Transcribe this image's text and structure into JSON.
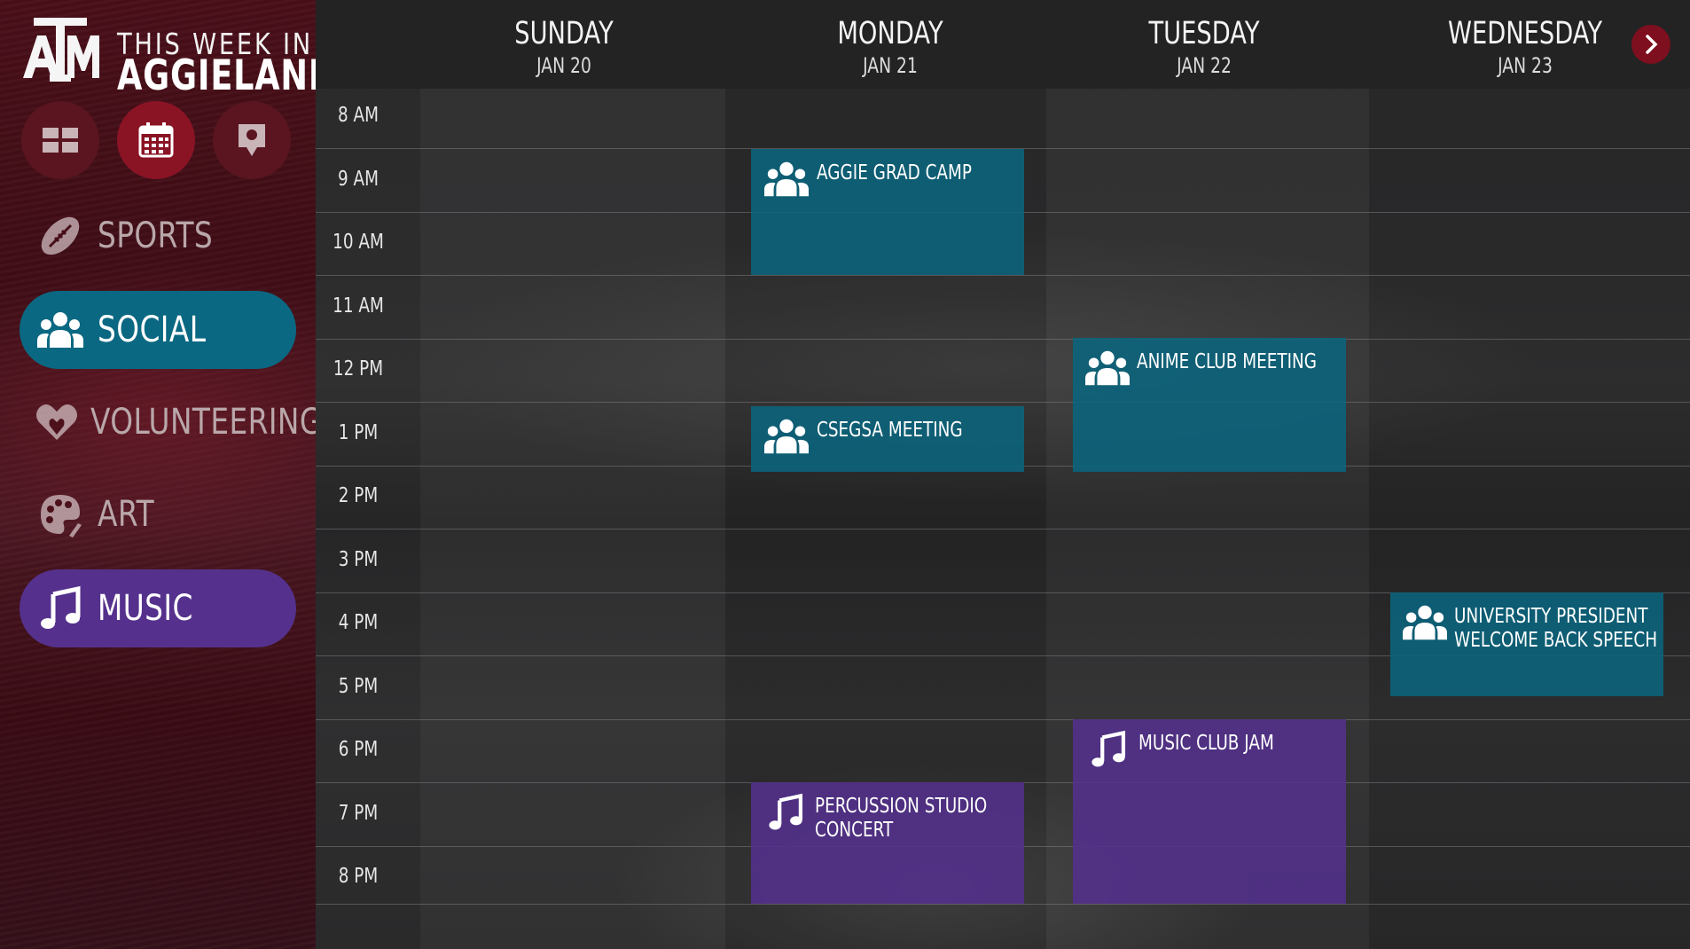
{
  "brand": {
    "logo_text": "ATM",
    "line1": "THIS WEEK IN",
    "line2": "AGGIELAND"
  },
  "colors": {
    "maroon": "#500000",
    "social": "#0b6882",
    "music": "#55318d",
    "active_view": "#8a1424"
  },
  "view_buttons": [
    {
      "icon": "dashboard-icon",
      "active": false
    },
    {
      "icon": "calendar-icon",
      "active": true
    },
    {
      "icon": "map-pin-icon",
      "active": false
    }
  ],
  "categories": [
    {
      "label": "SPORTS",
      "icon": "football-icon",
      "active": false
    },
    {
      "label": "SOCIAL",
      "icon": "group-icon",
      "active": true
    },
    {
      "label": "VOLUNTEERING",
      "icon": "heart-hands-icon",
      "active": false
    },
    {
      "label": "ART",
      "icon": "palette-icon",
      "active": false
    },
    {
      "label": "MUSIC",
      "icon": "music-note-icon",
      "active": true
    }
  ],
  "days": [
    {
      "name": "SUNDAY",
      "date": "JAN 20"
    },
    {
      "name": "MONDAY",
      "date": "JAN 21"
    },
    {
      "name": "TUESDAY",
      "date": "JAN 22"
    },
    {
      "name": "WEDNESDAY",
      "date": "JAN 23"
    }
  ],
  "next_button_icon": "chevron-right-icon",
  "hours": [
    "8 AM",
    "9 AM",
    "10 AM",
    "11 AM",
    "12 PM",
    "1 PM",
    "2 PM",
    "3 PM",
    "4 PM",
    "5 PM",
    "6 PM",
    "7 PM",
    "8 PM"
  ],
  "events": [
    {
      "title": "AGGIE GRAD CAMP",
      "day": "MONDAY",
      "category": "social",
      "icon": "group-icon",
      "start": "9 AM",
      "end": "11 AM"
    },
    {
      "title": "CSEGSA MEETING",
      "day": "MONDAY",
      "category": "social",
      "icon": "group-icon",
      "start": "1 PM",
      "end": "2 PM"
    },
    {
      "title": "ANIME CLUB MEETING",
      "day": "TUESDAY",
      "category": "social",
      "icon": "group-icon",
      "start": "12 PM",
      "end": "2 PM"
    },
    {
      "title": "UNIVERSITY PRESIDENT WELCOME BACK SPEECH",
      "title_lines": [
        "UNIVERSITY PRESIDENT",
        "WELCOME BACK SPEECH"
      ],
      "day": "WEDNESDAY",
      "category": "social",
      "icon": "group-icon",
      "start": "4 PM",
      "end": "5:40 PM"
    },
    {
      "title": "MUSIC CLUB JAM",
      "day": "TUESDAY",
      "category": "music",
      "icon": "music-note-icon",
      "start": "6 PM",
      "end": "9 PM"
    },
    {
      "title": "PERCUSSION STUDIO CONCERT",
      "title_lines": [
        "PERCUSSION STUDIO",
        "CONCERT"
      ],
      "day": "MONDAY",
      "category": "music",
      "icon": "music-note-icon",
      "start": "7 PM",
      "end": "9 PM"
    }
  ]
}
